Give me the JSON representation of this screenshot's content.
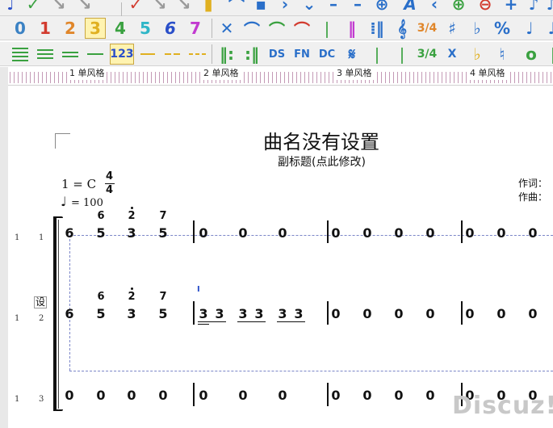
{
  "toolbar": {
    "numbers": [
      "0",
      "1",
      "2",
      "3",
      "4",
      "5",
      "6",
      "7"
    ],
    "number_colors": [
      "#3b82c4",
      "#d23b2f",
      "#e0862a",
      "#e0b020",
      "#3aa140",
      "#2fb6c7",
      "#2a4fc9",
      "#c23ad0"
    ],
    "selected_number": "3",
    "row3_labels": [
      "123",
      "DS",
      "FN",
      "DC",
      "X"
    ],
    "row2_glyphs": [
      "✕",
      "⌒",
      "⌒",
      "♯",
      "♭",
      "%"
    ],
    "row3_glyphs": [
      "𝄋",
      "𝄞",
      "♭",
      "♮",
      "o"
    ],
    "fraction_label": "3/4"
  },
  "ruler": {
    "measures": [
      "1 单风格",
      "2 单风格",
      "3 单风格",
      "4 单风格"
    ]
  },
  "score": {
    "title": "曲名没有设置",
    "subtitle": "副标题(点此修改)",
    "key": "1 = C",
    "time_top": "4",
    "time_bottom": "4",
    "tempo": "= 100",
    "lyricist_label": "作词：",
    "composer_label": "作曲：",
    "cursor_mark": "I",
    "set_label": "设",
    "staves": [
      {
        "left_no": "1",
        "right_no": "1"
      },
      {
        "left_no": "1",
        "right_no": "2"
      },
      {
        "left_no": "1",
        "right_no": "3"
      }
    ],
    "staff1": {
      "chord_top": [
        "6",
        "2",
        "7"
      ],
      "chord_mid": [
        "5",
        "3",
        "5"
      ],
      "notes": [
        "6",
        "5",
        "3",
        "5",
        "0",
        "0",
        "0",
        "0",
        "0",
        "0",
        "0",
        "0",
        "0",
        "0"
      ]
    },
    "staff2": {
      "chord_top": [
        "6",
        "2",
        "7"
      ],
      "chord_mid": [
        "5",
        "3",
        "5"
      ],
      "notes": [
        "6",
        "5",
        "3",
        "5",
        "3",
        "3",
        "3",
        "3",
        "3",
        "3",
        "0",
        "0",
        "0",
        "0",
        "0",
        "0",
        "0"
      ]
    },
    "staff3": {
      "notes": [
        "0",
        "0",
        "0",
        "0",
        "0",
        "0",
        "0",
        "0",
        "0",
        "0",
        "0",
        "0",
        "0",
        "0"
      ]
    }
  },
  "watermark": "Discuz!"
}
